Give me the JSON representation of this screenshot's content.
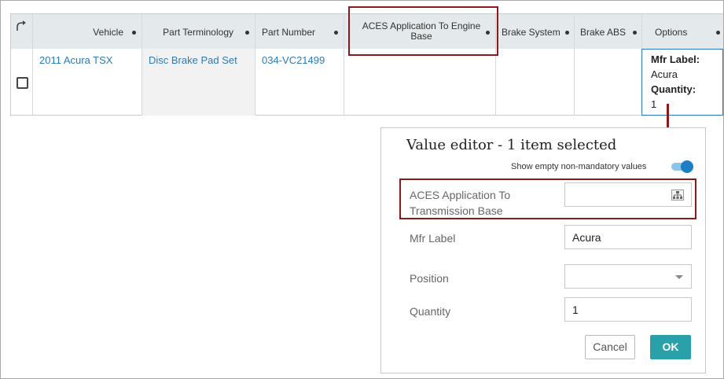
{
  "grid": {
    "columns": {
      "vehicle": "Vehicle",
      "part_terminology": "Part Terminology",
      "part_number": "Part Number",
      "aces_engine_base": "ACES Application To Engine Base",
      "brake_system": "Brake System",
      "brake_abs": "Brake ABS",
      "options": "Options"
    },
    "row": {
      "vehicle": "2011 Acura TSX",
      "part_terminology": "Disc Brake Pad Set",
      "part_number": "034-VC21499",
      "options": {
        "mfr_label_key": "Mfr Label:",
        "mfr_label_value": "Acura",
        "quantity_key": "Quantity:",
        "quantity_value": "1"
      }
    }
  },
  "editor": {
    "title": "Value editor - 1 item selected",
    "toggle_label": "Show empty non-mandatory values",
    "toggle_on": true,
    "fields": {
      "aces_transmission_base": {
        "label": "ACES Application To Transmission Base",
        "value": ""
      },
      "mfr_label": {
        "label": "Mfr Label",
        "value": "Acura"
      },
      "position": {
        "label": "Position",
        "value": ""
      },
      "quantity": {
        "label": "Quantity",
        "value": "1"
      }
    },
    "cancel_label": "Cancel",
    "ok_label": "OK"
  },
  "colors": {
    "highlight": "#8b1a1a",
    "link": "#2b7bb9",
    "ok_button": "#2aa0a8",
    "toggle": "#1a7fc4"
  },
  "icons": {
    "sort": "curved-arrow-icon",
    "column_menu": "dot-icon",
    "hierarchy": "hierarchy-icon",
    "dropdown": "chevron-down-icon"
  }
}
